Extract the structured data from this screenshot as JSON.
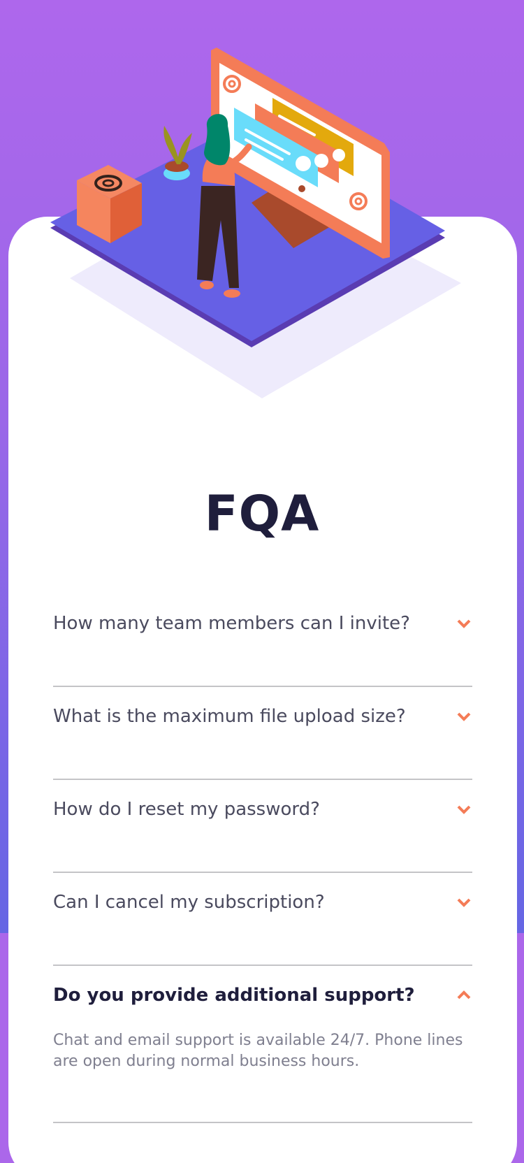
{
  "page": {
    "title": "FQA",
    "accent_color": "#f47c57",
    "title_color": "#1f1e3c",
    "text_color": "#4a4a5e",
    "answer_color": "#7f7f8f",
    "background_top": "#ae67ec",
    "background_bottom": "#6566e4"
  },
  "illustration": {
    "subject": "woman-at-email-monitor-illustration",
    "icons": [
      "at-symbol-icon",
      "at-symbol-icon",
      "at-symbol-icon"
    ]
  },
  "faq": {
    "items": [
      {
        "question": "How many team members can I invite?",
        "expanded": false,
        "chevron": "chevron-down-icon"
      },
      {
        "question": "What is the maximum file upload size?",
        "expanded": false,
        "chevron": "chevron-down-icon"
      },
      {
        "question": "How do I reset my password?",
        "expanded": false,
        "chevron": "chevron-down-icon"
      },
      {
        "question": "Can I cancel my subscription?",
        "expanded": false,
        "chevron": "chevron-down-icon"
      },
      {
        "question": "Do you provide additional support?",
        "expanded": true,
        "chevron": "chevron-up-icon",
        "answer": "Chat and email support is available 24/7. Phone lines are open during normal business hours."
      }
    ]
  }
}
